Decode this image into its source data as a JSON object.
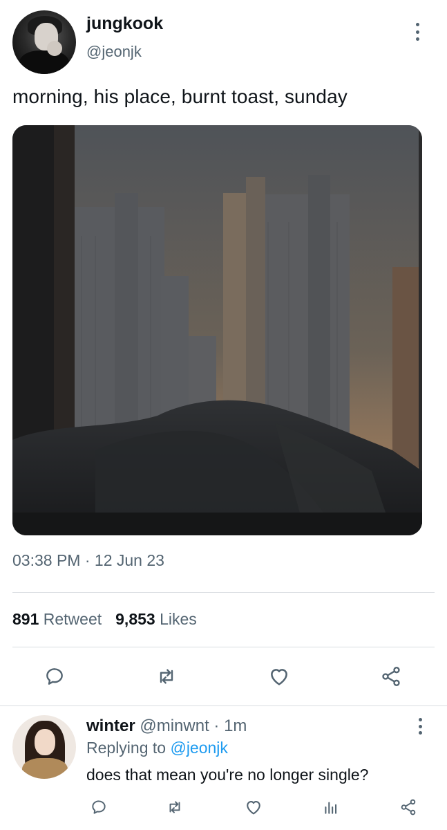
{
  "tweet": {
    "display_name": "jungkook",
    "handle": "@jeonjk",
    "text": "morning, his place, burnt toast, sunday",
    "time": "03:38 PM",
    "date_separator": " · ",
    "date": "12 Jun 23",
    "retweets_count": "891",
    "retweets_label": "Retweet",
    "likes_count": "9,853",
    "likes_label": "Likes",
    "avatar_icon": "avatar-photo",
    "more_icon": "more-vertical-icon"
  },
  "actions": [
    {
      "name": "reply",
      "icon": "reply-icon"
    },
    {
      "name": "retweet",
      "icon": "retweet-icon"
    },
    {
      "name": "like",
      "icon": "heart-icon"
    },
    {
      "name": "share",
      "icon": "share-icon"
    }
  ],
  "reply": {
    "display_name": "winter",
    "handle": "@minwnt",
    "separator": " · ",
    "age": "1m",
    "replying_label": "Replying to",
    "replying_to": "@jeonjk",
    "text": "does that mean you're no longer single?",
    "actions": [
      {
        "name": "reply",
        "icon": "reply-icon"
      },
      {
        "name": "retweet",
        "icon": "retweet-icon"
      },
      {
        "name": "like",
        "icon": "heart-icon"
      },
      {
        "name": "analytics",
        "icon": "analytics-icon"
      },
      {
        "name": "share",
        "icon": "share-icon"
      }
    ]
  },
  "colors": {
    "text": "#0f1419",
    "secondary": "#536471",
    "link": "#1d9bf0",
    "divider": "#d9dde1"
  }
}
